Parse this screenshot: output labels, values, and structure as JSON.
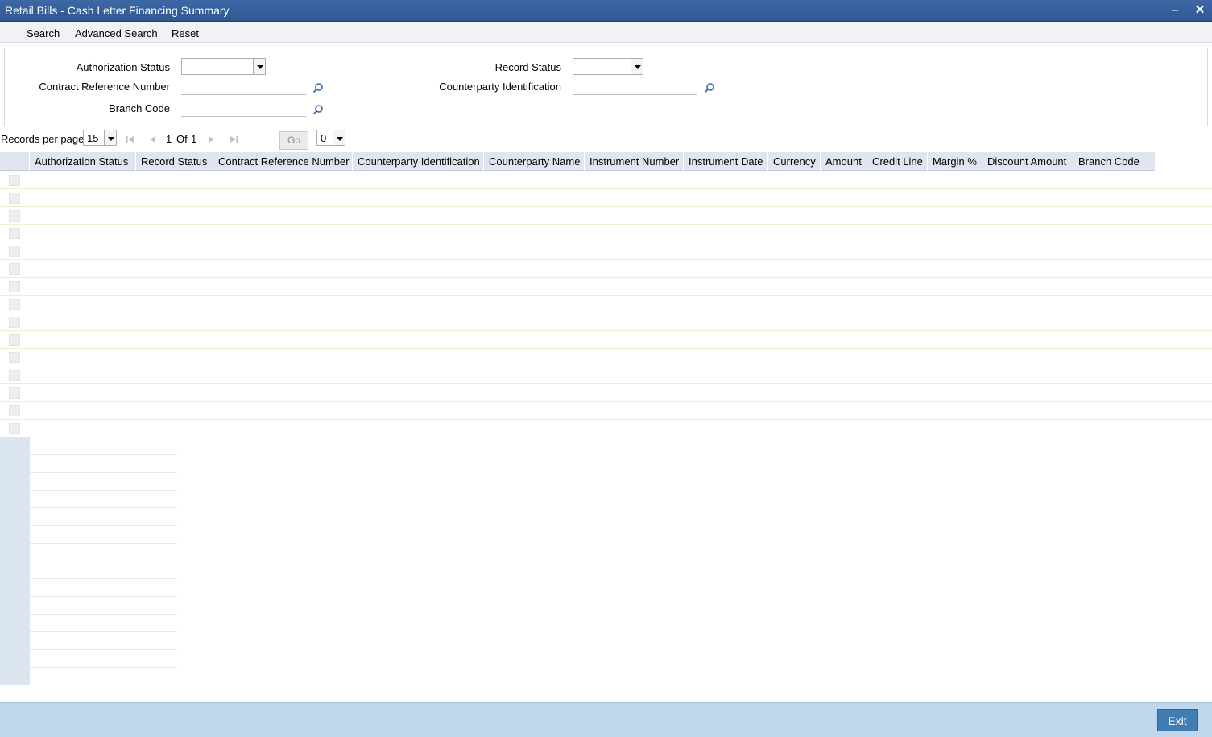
{
  "window": {
    "title": "Retail Bills - Cash Letter Financing Summary",
    "minimize": "‒",
    "close": "✕"
  },
  "toolbar": {
    "search": "Search",
    "advanced_search": "Advanced Search",
    "reset": "Reset"
  },
  "criteria": {
    "authorization_status_label": "Authorization Status",
    "authorization_status_value": "",
    "record_status_label": "Record Status",
    "record_status_value": "",
    "contract_ref_label": "Contract Reference Number",
    "contract_ref_value": "",
    "counterparty_id_label": "Counterparty Identification",
    "counterparty_id_value": "",
    "branch_code_label": "Branch Code",
    "branch_code_value": ""
  },
  "pager": {
    "records_per_page_label": "Records per page",
    "records_per_page_value": "15",
    "current_page": "1",
    "of_label": "Of",
    "total_pages": "1",
    "go_label": "Go",
    "page_select_value": "0"
  },
  "grid": {
    "columns": [
      "Authorization Status",
      "Record Status",
      "Contract Reference Number",
      "Counterparty Identification",
      "Counterparty Name",
      "Instrument Number",
      "Instrument Date",
      "Currency",
      "Amount",
      "Credit Line",
      "Margin %",
      "Discount Amount",
      "Branch Code"
    ],
    "rows": []
  },
  "footer": {
    "exit_label": "Exit"
  },
  "colors": {
    "titlebar": "#2f5893",
    "header": "#dfe6ef",
    "footer": "#bfd7ec",
    "exit_button": "#3f7db3"
  }
}
